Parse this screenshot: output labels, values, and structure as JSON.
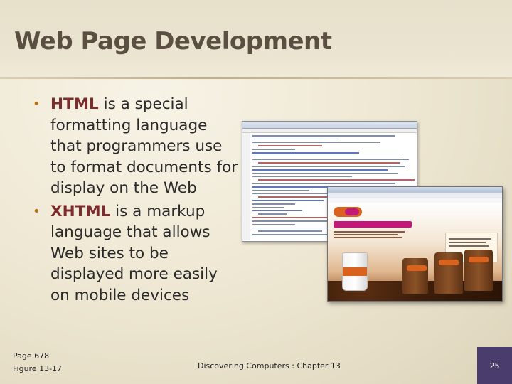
{
  "slide": {
    "title": "Web Page Development",
    "bullets": [
      {
        "term": "HTML",
        "text": " is a special formatting language that programmers use to format documents for display on the Web"
      },
      {
        "term": "XHTML",
        "text": " is a markup language that allows Web sites to be displayed more easily on mobile devices"
      }
    ],
    "footer": {
      "page_ref": "Page 678",
      "figure_ref": "Figure 13-17",
      "course": "Discovering Computers : Chapter 13",
      "slide_number": "25"
    }
  },
  "colors": {
    "title": "#5b4f42",
    "bullet_term": "#7b2d2d",
    "bullet_marker": "#b5701a",
    "page_number_box": "#4a3d6e"
  },
  "figure": {
    "description_icons": [
      "html-code-editor-window-icon",
      "browser-window-icon",
      "coffee-cup-icon",
      "coffee-bag-icon"
    ]
  }
}
